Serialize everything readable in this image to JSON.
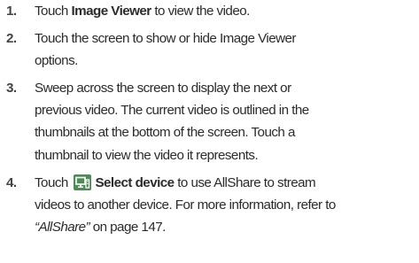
{
  "steps": [
    {
      "number": "1.",
      "pre": "Touch ",
      "bold": "Image Viewer",
      "post": " to view the video."
    },
    {
      "number": "2.",
      "line1": "Touch the screen to show or hide Image Viewer",
      "line2": "options."
    },
    {
      "number": "3.",
      "line1": "Sweep across the screen to display the next or",
      "line2": "previous video. The current video is outlined in the",
      "line3": "thumbnails at the bottom of the screen. Touch a",
      "line4": "thumbnail to view the video it represents."
    },
    {
      "number": "4.",
      "pre": "Touch ",
      "icon": "select-device-icon",
      "bold": "Select device",
      "post": " to use AllShare to stream",
      "line2": "videos to another device. For more information, refer to",
      "ref": "“AllShare”",
      "ref_post": "  on page 147."
    }
  ],
  "colors": {
    "text": "#2b2b2b",
    "icon_bg": "#4d8c57"
  }
}
